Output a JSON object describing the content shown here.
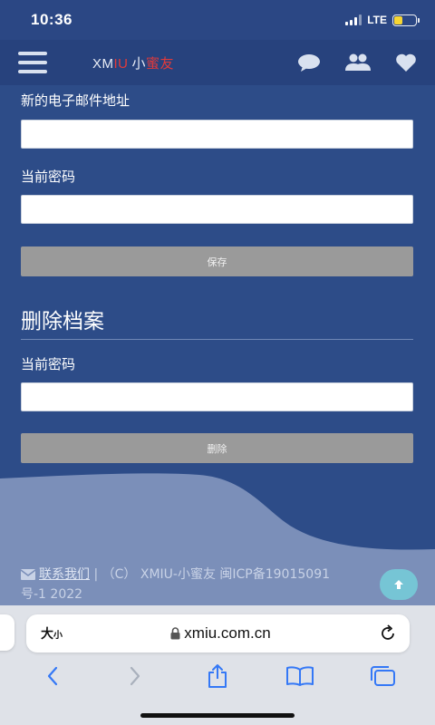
{
  "status_bar": {
    "time": "10:36",
    "network": "LTE",
    "battery_level": 0.4
  },
  "nav": {
    "logo_parts": [
      "XM",
      "IU",
      "小",
      "蜜友"
    ],
    "icons": [
      "menu-icon",
      "chat-icon",
      "friends-icon",
      "heart-icon"
    ]
  },
  "form_change_email": {
    "email_label": "新的电子邮件地址",
    "email_value": "",
    "password_label": "当前密码",
    "password_value": "",
    "save_label": "保存"
  },
  "delete_profile": {
    "title": "删除档案",
    "password_label": "当前密码",
    "password_value": "",
    "delete_label": "删除"
  },
  "footer": {
    "contact_label": "联系我们",
    "separator": " |",
    "copyright_line": "（C） XMIU-小蜜友 闽ICP备19015091号-1 2022"
  },
  "browser": {
    "text_size_large": "大",
    "text_size_small": "小",
    "url": "xmiu.com.cn"
  },
  "colors": {
    "page_bg": "#2d4c88",
    "nav_bg": "#27427d",
    "wave": "#7b8fb9",
    "button_gray": "#9a9a9a",
    "accent_red": "#e23a3a",
    "top_button": "#76c5d5",
    "ios_blue": "#3478f6"
  }
}
